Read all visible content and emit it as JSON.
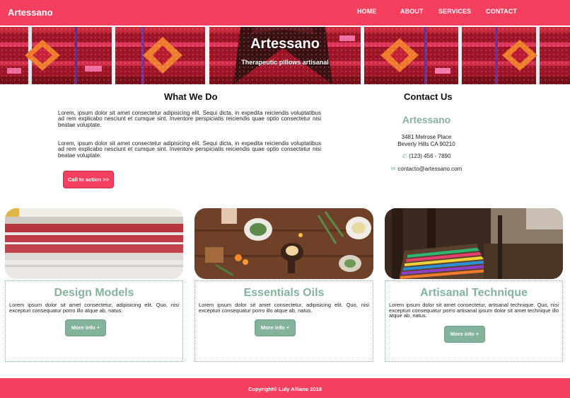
{
  "nav": {
    "brand": "Artessano",
    "links": [
      "HOME",
      "ABOUT",
      "SERVICES",
      "CONTACT"
    ]
  },
  "hero": {
    "title": "Artessano",
    "subtitle": "Therapeutic pillows artisanal"
  },
  "about": {
    "heading": "What We Do",
    "paragraphs": [
      "Lorem, ipsum dolor sit amet consectetur adipisicing elit. Sequi dicta, in expedita reiciendis voluptatibus ad rem explicabo nesciunt et cumque sint. Inventore perspiciatis reiciendis quae optio consectetur nisi beatae voluptate.",
      "Lorem, ipsum dolor sit amet consectetur adipisicing elit. Sequi dicta, in expedita reiciendis voluptatibus ad rem explicabo nesciunt et cumque sint. Inventore perspiciatis reiciendis quae optio consectetur nisi beatae voluptate."
    ],
    "cta_label": "Call to action >>"
  },
  "contact": {
    "heading": "Contact Us",
    "brand": "Artessano",
    "address_line1": "3481 Melrose Place",
    "address_line2": "Beverly Hills CA 90210",
    "phone": "(123) 456 - 7890",
    "email": "contacto@artessano.com",
    "phone_icon": "phone-icon",
    "email_icon": "envelope-icon"
  },
  "cards": [
    {
      "title": "Design Models",
      "text": "Lorem ipsum dolor sit amet consectetur, adipisicing elit. Quo, nisi excepturi consequatur porro illo atque ab, natus.",
      "button": "More info +"
    },
    {
      "title": "Essentials Oils",
      "text": "Lorem ipsum dolor sit amet consectetur, adipisicing elit. Quo, nisi excepturi consequatur porro illo atque ab, natus.",
      "button": "More info +"
    },
    {
      "title": "Artisanal Technique",
      "text": "Lorem ipsum dolor sit amet consectetur, artisanal technique. Quo, nisi excepturi consequatur porro artisanal ipsum dolor sit amet technique illo atque ab, natus.",
      "button": "More info +"
    }
  ],
  "footer": {
    "text": "Copyright© Luly Alliano 2018"
  },
  "colors": {
    "brand_pink": "#f43f5e",
    "accent_green": "#84b39b"
  }
}
